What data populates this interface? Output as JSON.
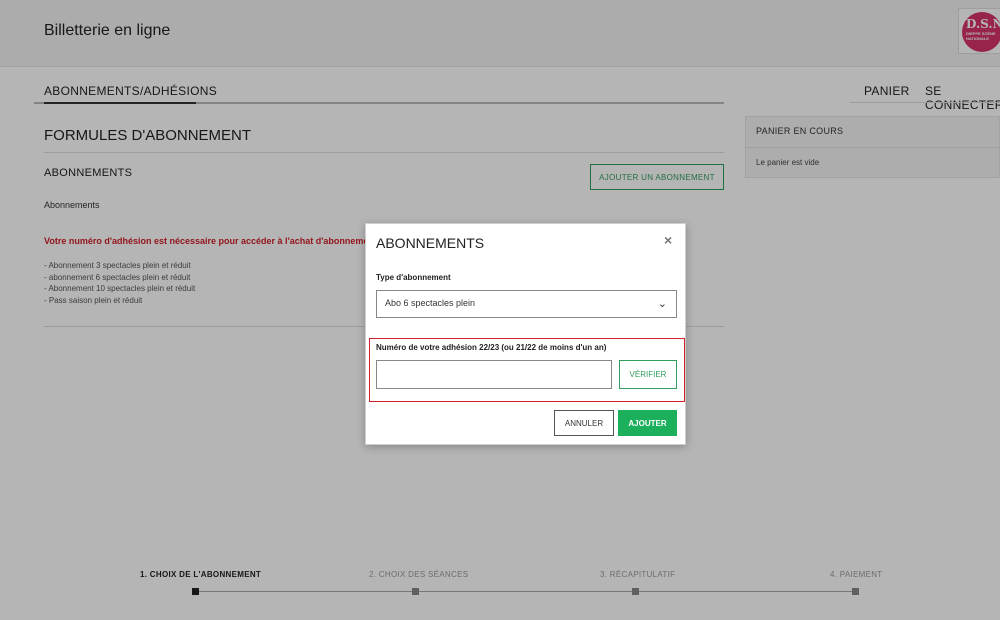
{
  "header": {
    "site_title": "Billetterie en ligne",
    "logo_text": "D.S.N",
    "logo_small_text": "DIEPPE SCÈNE NATIONALE",
    "logo_color": "#d6336c"
  },
  "nav": {
    "tab_subscriptions": "ABONNEMENTS/ADHÉSIONS",
    "cart": "PANIER",
    "login": "SE CONNECTER"
  },
  "main": {
    "section_title": "FORMULES D'ABONNEMENT",
    "subtitle": "ABONNEMENTS",
    "add_button": "AJOUTER UN ABONNEMENT",
    "intro": "Abonnements",
    "warning": "Votre numéro d'adhésion est nécessaire pour accéder à l'achat d'abonnement.",
    "warning_color": "#d0202a",
    "list_items": [
      "- Abonnement 3 spectacles plein et réduit",
      "- abonnement 6 spectacles plein et réduit",
      "- Abonnement 10 spectacles plein et réduit",
      "- Pass saison plein et réduit"
    ]
  },
  "cart_panel": {
    "title": "PANIER EN COURS",
    "empty_text": "Le panier est vide"
  },
  "steps": [
    {
      "label": "1. CHOIX DE L'ABONNEMENT",
      "active": true
    },
    {
      "label": "2. CHOIX DES SÉANCES",
      "active": false
    },
    {
      "label": "3. RÉCAPITULATIF",
      "active": false
    },
    {
      "label": "4. PAIEMENT",
      "active": false
    }
  ],
  "modal": {
    "title": "ABONNEMENTS",
    "close_icon": "close-icon",
    "type_label": "Type d'abonnement",
    "type_selected": "Abo 6 spectacles plein",
    "member_label": "Numéro de votre adhésion 22/23 (ou 21/22 de moins d'un an)",
    "member_value": "",
    "verify_button": "VÉRIFIER",
    "cancel_button": "ANNULER",
    "add_button": "AJOUTER",
    "accent_color": "#1db05c",
    "highlight_color": "#d0202a"
  }
}
